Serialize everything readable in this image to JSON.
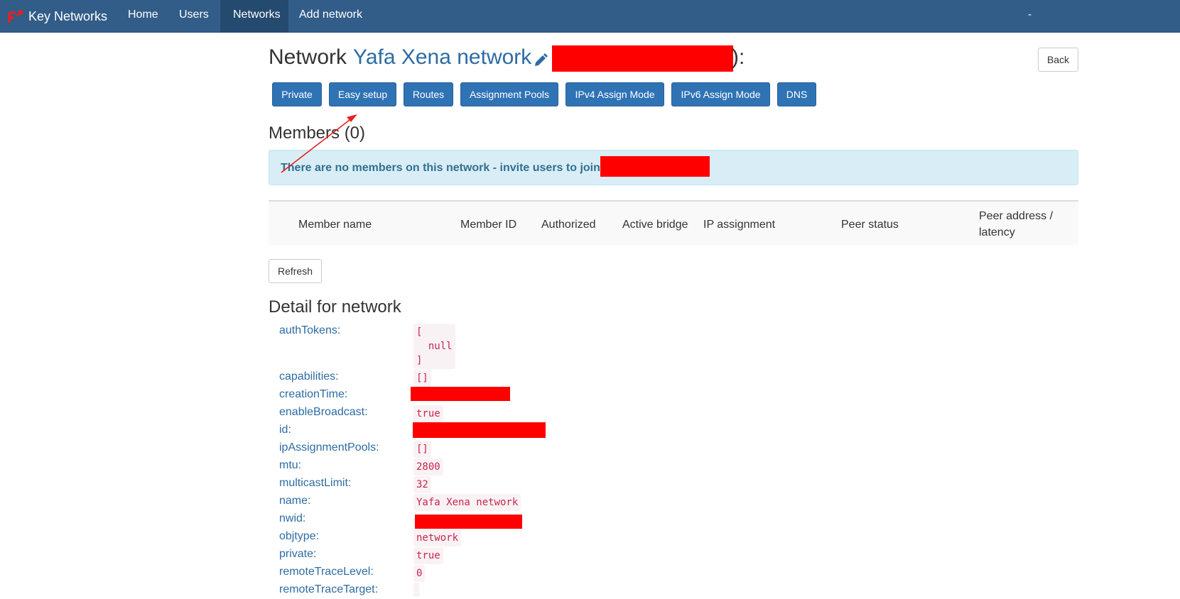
{
  "navbar": {
    "brand": "Key Networks",
    "items": [
      {
        "label": "Home"
      },
      {
        "label": "Users"
      },
      {
        "label": "Networks"
      },
      {
        "label": "Add network"
      }
    ],
    "user": "-"
  },
  "header": {
    "prefix": "Network",
    "network_name": "Yafa Xena network",
    "suffix": "):",
    "back_label": "Back"
  },
  "actions": [
    {
      "label": "Private"
    },
    {
      "label": "Easy setup"
    },
    {
      "label": "Routes"
    },
    {
      "label": "Assignment Pools"
    },
    {
      "label": "IPv4 Assign Mode"
    },
    {
      "label": "IPv6 Assign Mode"
    },
    {
      "label": "DNS"
    }
  ],
  "members": {
    "title": "Members (0)",
    "empty_message": "There are no members on this network - invite users to join",
    "columns": [
      {
        "label": "Member name"
      },
      {
        "label": "Member ID"
      },
      {
        "label": "Authorized"
      },
      {
        "label": "Active bridge"
      },
      {
        "label": "IP assignment"
      },
      {
        "label": "Peer status"
      },
      {
        "label": "Peer address / latency"
      }
    ],
    "refresh_label": "Refresh"
  },
  "detail": {
    "title": "Detail for network",
    "fields": [
      {
        "key": "authTokens:",
        "value": "[\n  null\n]"
      },
      {
        "key": "capabilities:",
        "value": "[]"
      },
      {
        "key": "creationTime:",
        "value": ""
      },
      {
        "key": "enableBroadcast:",
        "value": "true"
      },
      {
        "key": "id:",
        "value": ""
      },
      {
        "key": "ipAssignmentPools:",
        "value": "[]"
      },
      {
        "key": "mtu:",
        "value": "2800"
      },
      {
        "key": "multicastLimit:",
        "value": "32"
      },
      {
        "key": "name:",
        "value": "Yafa Xena network"
      },
      {
        "key": "nwid:",
        "value": ""
      },
      {
        "key": "objtype:",
        "value": "network"
      },
      {
        "key": "private:",
        "value": "true"
      },
      {
        "key": "remoteTraceLevel:",
        "value": "0"
      },
      {
        "key": "remoteTraceTarget:",
        "value": ""
      }
    ]
  },
  "colors": {
    "navbar": "#325d88",
    "primary_button": "#2f73b5",
    "link": "#2d6ca2",
    "redaction": "#ff0000",
    "annotation_arrow": "#e8201e"
  },
  "icons": {
    "brand": "network-logo-icon",
    "edit": "pencil-icon"
  }
}
